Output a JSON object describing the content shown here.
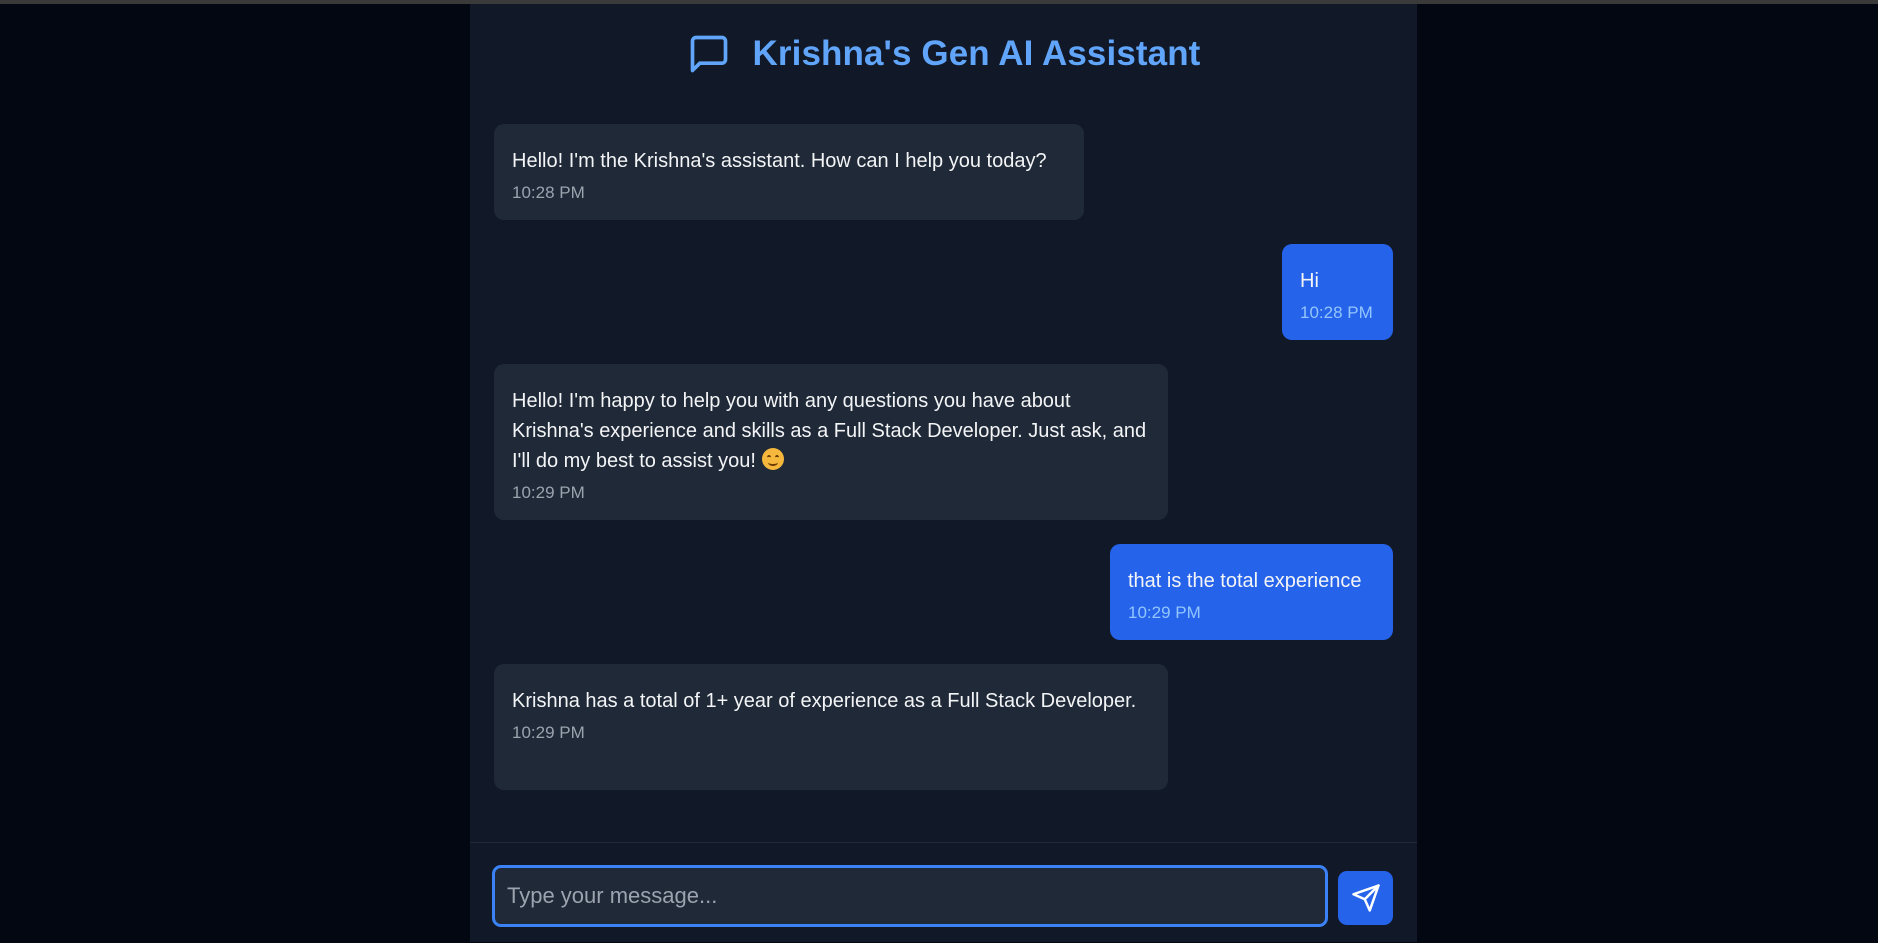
{
  "app": {
    "title": "Krishna's Gen AI Assistant",
    "header_icon": "message-square-icon"
  },
  "messages": [
    {
      "role": "assistant",
      "text": "Hello! I'm the Krishna's assistant. How can I help you today?",
      "time": "10:28 PM"
    },
    {
      "role": "user",
      "text": "Hi",
      "time": "10:28 PM"
    },
    {
      "role": "assistant",
      "text": "Hello! I'm happy to help you with any questions you have about Krishna's experience and skills as a Full Stack Developer. Just ask, and I'll do my best to assist you!",
      "emoji": "smiling-face-emoji",
      "time": "10:29 PM"
    },
    {
      "role": "user",
      "text": "that is the total experience",
      "time": "10:29 PM"
    },
    {
      "role": "assistant",
      "text": "Krishna has a total of 1+ year of experience as a Full Stack Developer.",
      "time": "10:29 PM"
    }
  ],
  "composer": {
    "placeholder": "Type your message...",
    "value": "",
    "send_icon": "send-icon"
  },
  "colors": {
    "page_bg": "#030712",
    "panel_bg": "#111827",
    "bot_bubble": "#1f2937",
    "user_bubble": "#2563eb",
    "accent": "#60a5fa"
  }
}
